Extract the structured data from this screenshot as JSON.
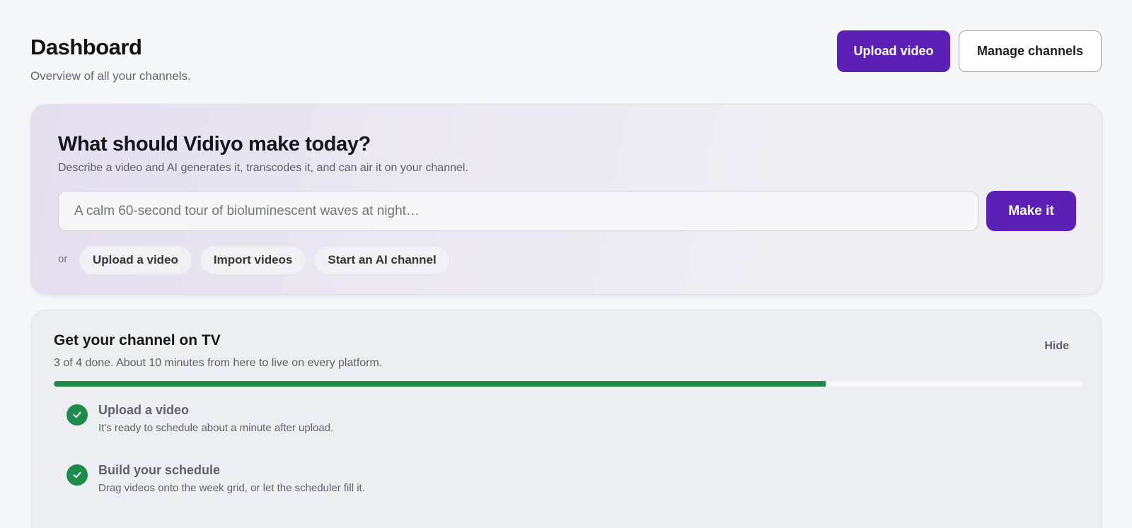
{
  "header": {
    "title": "Dashboard",
    "subtitle": "Overview of all your channels.",
    "upload_label": "Upload video",
    "manage_label": "Manage channels"
  },
  "hero": {
    "title": "What should Vidiyo make today?",
    "subtitle": "Describe a video and AI generates it, transcodes it, and can air it on your channel.",
    "input_placeholder": "A calm 60-second tour of bioluminescent waves at night…",
    "input_value": "",
    "make_label": "Make it",
    "or_label": "or",
    "chips": [
      "Upload a video",
      "Import videos",
      "Start an AI channel"
    ]
  },
  "checklist": {
    "title": "Get your channel on TV",
    "subtitle": "3 of 4 done. About 10 minutes from here to live on every platform.",
    "hide_label": "Hide",
    "progress_fraction": 0.75,
    "progress_color": "#1e8a4c",
    "steps": [
      {
        "title": "Upload a video",
        "desc": "It's ready to schedule about a minute after upload.",
        "done": true,
        "icon": "check-icon"
      },
      {
        "title": "Build your schedule",
        "desc": "Drag videos onto the week grid, or let the scheduler fill it.",
        "done": true,
        "icon": "check-icon"
      }
    ]
  },
  "colors": {
    "accent": "#5b21b6",
    "success": "#1e8a4c"
  }
}
